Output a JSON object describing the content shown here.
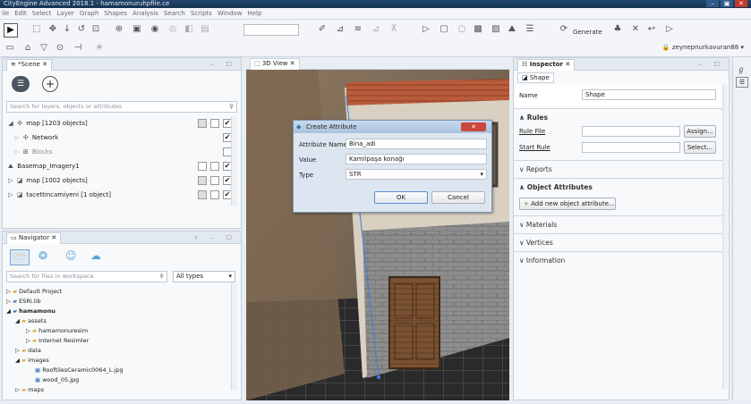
{
  "window": {
    "title": "CityEngine Advanced 2018.1 - hamamonuruhpfile.ce",
    "min": "–",
    "max": "▣",
    "close": "✕"
  },
  "menu": [
    "ile",
    "Edit",
    "Select",
    "Layer",
    "Graph",
    "Shapes",
    "Analysis",
    "Search",
    "Scripts",
    "Window",
    "Help"
  ],
  "toolbar": {
    "generate_label": "Generate",
    "user": "zeynepnurkavuran88"
  },
  "scene": {
    "tab": "*Scene",
    "search_placeholder": "Search for layers, objects or attributes",
    "rows": [
      {
        "label": "map [1203 objects]",
        "checks": [
          false,
          true
        ]
      },
      {
        "label": "Network",
        "checks": [
          true
        ]
      },
      {
        "label": "Blocks",
        "checks": [
          false
        ]
      },
      {
        "label": "Basemap_Imagery1",
        "checks": [
          false,
          false,
          true
        ]
      },
      {
        "label": "map [1002 objects]",
        "checks": [
          false,
          false,
          true
        ]
      },
      {
        "label": "tacettincamiyeni [1 object]",
        "checks": [
          false,
          false,
          true
        ]
      }
    ]
  },
  "navigator": {
    "tab": "Navigator",
    "search_placeholder": "Search for files in workspace",
    "filter": "All types",
    "items": [
      {
        "label": "Default Project",
        "indent": 0
      },
      {
        "label": "ESRI.lib",
        "indent": 0
      },
      {
        "label": "hamamonu",
        "indent": 0
      },
      {
        "label": "assets",
        "indent": 1
      },
      {
        "label": "hamamonuresim",
        "indent": 2
      },
      {
        "label": "Internet Resimler",
        "indent": 2
      },
      {
        "label": "data",
        "indent": 1
      },
      {
        "label": "images",
        "indent": 1
      },
      {
        "label": "RooftilesCeramic0064_L.jpg",
        "indent": 2
      },
      {
        "label": "wood_05.jpg",
        "indent": 2
      },
      {
        "label": "maps",
        "indent": 1
      }
    ]
  },
  "view3d": {
    "tab": "3D View"
  },
  "dialog": {
    "title": "Create Attribute",
    "name_label": "Attribute Name",
    "name_value": "Bina_adi",
    "value_label": "Value",
    "value_value": "Kamilpaşa konağı",
    "type_label": "Type",
    "type_value": "STR",
    "ok": "OK",
    "cancel": "Cancel"
  },
  "inspector": {
    "tab": "Inspector",
    "subtab": "Shape",
    "name_label": "Name",
    "name_value": "Shape",
    "rules": "Rules",
    "rule_file": "Rule File",
    "start_rule": "Start Rule",
    "assign": "Assign...",
    "select": "Select...",
    "reports": "Reports",
    "object_attributes": "Object Attributes",
    "add_attr": "Add new object attribute...",
    "materials": "Materials",
    "vertices": "Vertices",
    "information": "Information"
  }
}
